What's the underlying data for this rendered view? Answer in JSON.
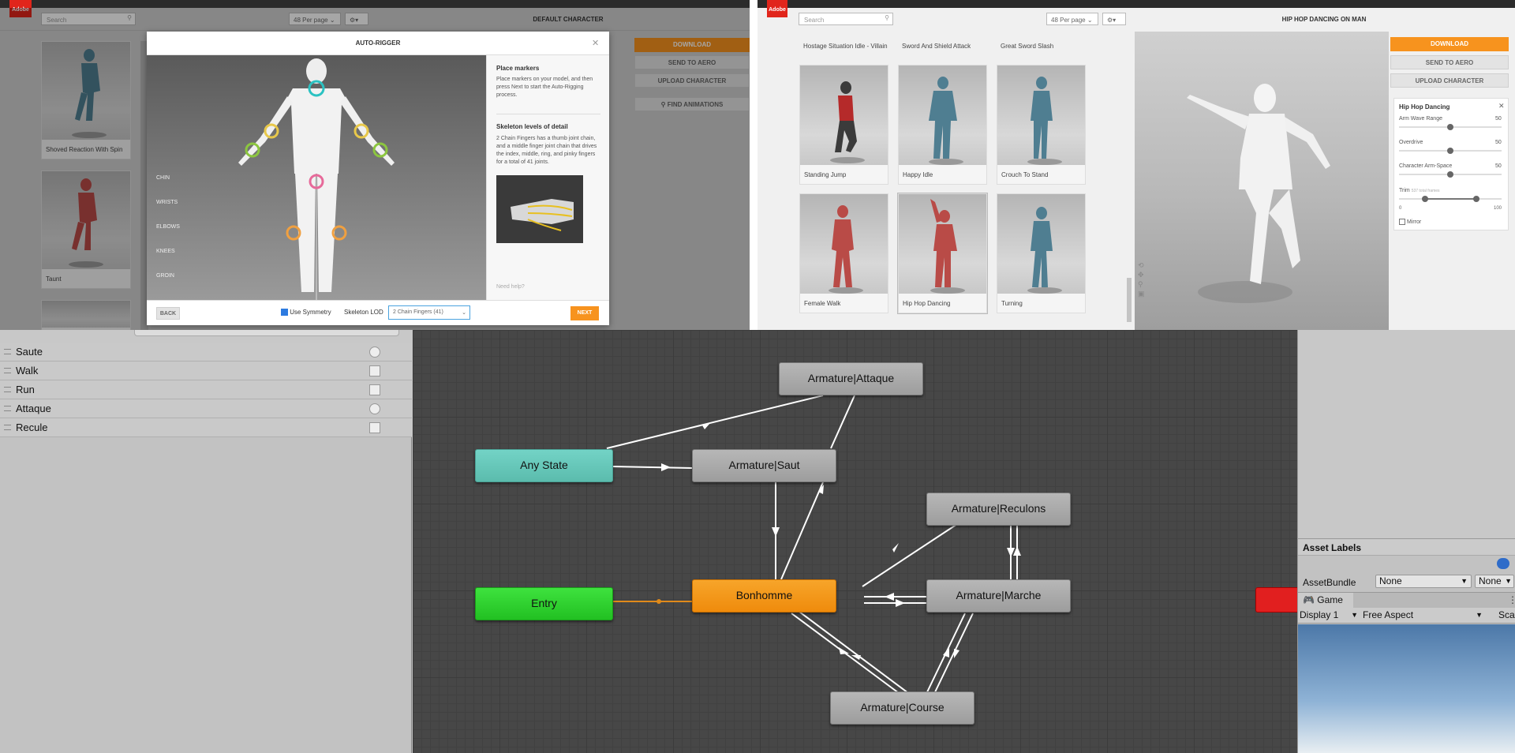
{
  "left_mixamo": {
    "logo": "Adobe",
    "search_placeholder": "Search",
    "per_page": "48 Per page",
    "character_title": "DEFAULT CHARACTER",
    "cards": [
      {
        "label": "Shoved Reaction With Spin"
      },
      {
        "label": "Taunt"
      }
    ],
    "buttons": {
      "download": "DOWNLOAD",
      "send_to_aero": "SEND TO AERO",
      "upload_character": "UPLOAD CHARACTER",
      "find_animations": "FIND ANIMATIONS"
    },
    "autorigger": {
      "title": "AUTO-RIGGER",
      "joint_labels": [
        "CHIN",
        "WRISTS",
        "ELBOWS",
        "KNEES",
        "GROIN"
      ],
      "place_markers_heading": "Place markers",
      "place_markers_text": "Place markers on your model, and then press Next to start the Auto-Rigging process.",
      "skeleton_heading": "Skeleton levels of detail",
      "skeleton_text": "2 Chain Fingers has a thumb joint chain, and a middle finger joint chain that drives the index, middle, ring, and pinky fingers for a total of 41 joints.",
      "need_help": "Need help?",
      "back": "BACK",
      "use_symmetry": "Use Symmetry",
      "skeleton_lod_label": "Skeleton LOD",
      "skeleton_lod_value": "2 Chain Fingers (41)",
      "next": "NEXT"
    }
  },
  "right_mixamo": {
    "logo": "Adobe",
    "search_placeholder": "Search",
    "per_page": "48 Per page",
    "character_title": "HIP HOP DANCING ON MAN",
    "top_row_labels": [
      "Hostage Situation Idle - Villain",
      "Sword And Shield Attack",
      "Great Sword Slash"
    ],
    "cards": [
      {
        "label": "Standing Jump"
      },
      {
        "label": "Happy Idle"
      },
      {
        "label": "Crouch To Stand"
      },
      {
        "label": "Female Walk"
      },
      {
        "label": "Hip Hop Dancing"
      },
      {
        "label": "Turning"
      }
    ],
    "buttons": {
      "download": "DOWNLOAD",
      "send_to_aero": "SEND TO AERO",
      "upload_character": "UPLOAD CHARACTER"
    },
    "settings": {
      "title": "Hip Hop Dancing",
      "sliders": [
        {
          "label": "Arm Wave Range",
          "value": "50",
          "fraction": 0.5
        },
        {
          "label": "Overdrive",
          "value": "50",
          "fraction": 0.5
        },
        {
          "label": "Character Arm-Space",
          "value": "50",
          "fraction": 0.5
        }
      ],
      "trim_label": "Trim",
      "trim_sub": "537 total frames",
      "trim_min": "0",
      "trim_max": "100",
      "trim_range": [
        0.25,
        0.75
      ],
      "mirror": "Mirror"
    }
  },
  "unity": {
    "parameters": [
      {
        "name": "Saute",
        "type": "trigger"
      },
      {
        "name": "Walk",
        "type": "bool"
      },
      {
        "name": "Run",
        "type": "bool"
      },
      {
        "name": "Attaque",
        "type": "trigger"
      },
      {
        "name": "Recule",
        "type": "bool"
      }
    ],
    "states": {
      "attaque": "Armature|Attaque",
      "any_state": "Any State",
      "saut": "Armature|Saut",
      "reculons": "Armature|Reculons",
      "entry": "Entry",
      "bonhomme": "Bonhomme",
      "marche": "Armature|Marche",
      "course": "Armature|Course"
    },
    "asset_labels": "Asset Labels",
    "asset_bundle_label": "AssetBundle",
    "asset_bundle_value": "None",
    "asset_bundle_variant": "None",
    "game_tab": "Game",
    "display": "Display 1",
    "aspect": "Free Aspect",
    "scale": "Sca"
  }
}
